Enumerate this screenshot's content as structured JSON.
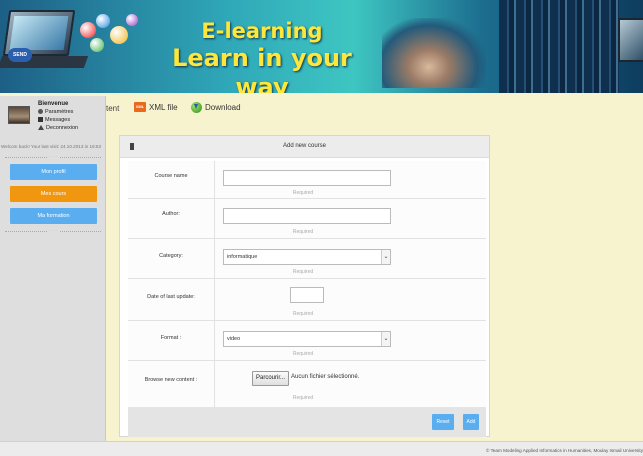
{
  "banner": {
    "title_line1": "E-learning",
    "title_line2": "Learn in your way",
    "send_label": "SEND"
  },
  "sidebar": {
    "welcome": "Bienvenue",
    "menu": [
      {
        "label": "Paramètres",
        "icon": "gear-icon"
      },
      {
        "label": "Messages",
        "icon": "envelope-icon"
      },
      {
        "label": "Deconnexion",
        "icon": "exit-icon"
      }
    ],
    "last_visit": "Welcom back! Your last visit: 24.10.2013 in 16:53",
    "divider_text": "······",
    "nav": [
      {
        "label": "Mon profil",
        "color": "#5aaef0"
      },
      {
        "label": "Mes cours",
        "color": "#f0960f"
      },
      {
        "label": "Ma formation",
        "color": "#5aaef0"
      }
    ]
  },
  "toolbar": {
    "cut_tab": "tent",
    "xml_label": "XML file",
    "xml_icon_text": "XML",
    "download_label": "Download"
  },
  "form": {
    "title": "Add new course",
    "required_text": "Required",
    "course_name": {
      "label": "Course name",
      "value": ""
    },
    "author": {
      "label": "Author:",
      "value": ""
    },
    "category": {
      "label": "Category:",
      "value": "informatique"
    },
    "date": {
      "label": "Date of last update:",
      "value": ""
    },
    "format": {
      "label": "Format :",
      "value": "video"
    },
    "browse": {
      "label": "Browse new content :",
      "button": "Parcourir...",
      "status": "Aucun fichier sélectionné."
    },
    "reset_label": "Reset",
    "add_label": "Add"
  },
  "footer": {
    "text": "© Team Modeling Applied Informatics in Humanities, Moulay Ismail University"
  },
  "colors": {
    "accent_blue": "#5aaef0",
    "accent_orange": "#f0960f",
    "banner_yellow": "#ffe63a",
    "page_bg": "#f8f3cf"
  }
}
